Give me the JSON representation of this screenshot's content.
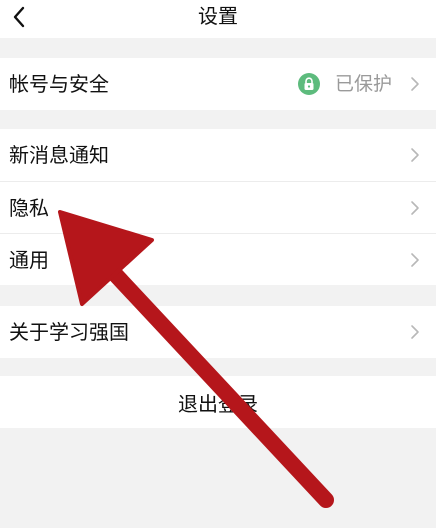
{
  "header": {
    "title": "设置",
    "back_icon": "chevron-left-icon"
  },
  "groups": [
    {
      "items": [
        {
          "label": "帐号与安全",
          "value": "已保护",
          "status_icon": "lock-icon",
          "status_color": "#5dbb7d"
        }
      ]
    },
    {
      "items": [
        {
          "label": "新消息通知"
        },
        {
          "label": "隐私"
        },
        {
          "label": "通用"
        }
      ]
    },
    {
      "items": [
        {
          "label": "关于学习强国"
        }
      ]
    }
  ],
  "logout_label": "退出登录",
  "annotation": {
    "type": "arrow",
    "color": "#b5161b",
    "target": "隐私"
  }
}
